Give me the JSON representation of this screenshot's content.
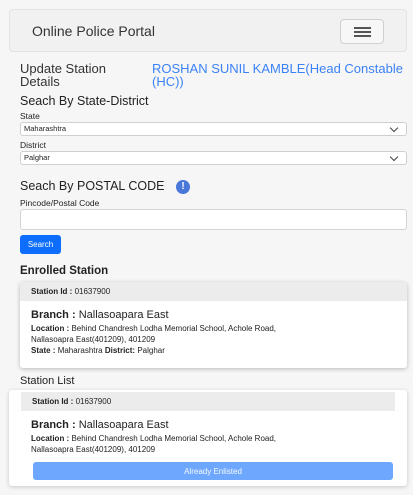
{
  "navbar": {
    "brand": "Online Police Portal",
    "toggler_icon": "hamburger-icon"
  },
  "update_details": {
    "label": "Update Station Details",
    "officer_name": "ROSHAN SUNIL KAMBLE(Head Constable (HC))"
  },
  "search_state_district": {
    "heading": "Seach By State-District",
    "state_label": "State",
    "state_value": "Maharashtra",
    "district_label": "District",
    "district_value": "Palghar"
  },
  "search_postal": {
    "heading": "Seach By POSTAL CODE",
    "info_icon_text": "!",
    "pincode_label": "Pincode/Postal Code",
    "pincode_value": "",
    "search_button": "Search"
  },
  "enrolled_station": {
    "heading": "Enrolled Station",
    "station_id_label": "Station Id :",
    "station_id": "01637900",
    "branch_label": "Branch :",
    "branch": "Nallasoapara East",
    "location_label": "Location :",
    "location": "Behind Chandresh Lodha Memorial School, Achole Road,",
    "location_line2": "Nallasoapra East(401209), 401209",
    "state_label": "State :",
    "state": "Maharashtra",
    "district_label": "District:",
    "district": "Palghar"
  },
  "station_list": {
    "heading": "Station List",
    "items": [
      {
        "station_id_label": "Station Id :",
        "station_id": "01637900",
        "branch_label": "Branch :",
        "branch": "Nallasoapara East",
        "location_label": "Location :",
        "location": "Behind Chandresh Lodha Memorial School, Achole Road,",
        "location_line2": "Nallasoapra East(401209), 401209",
        "action_label": "Already Enlisted"
      }
    ]
  }
}
